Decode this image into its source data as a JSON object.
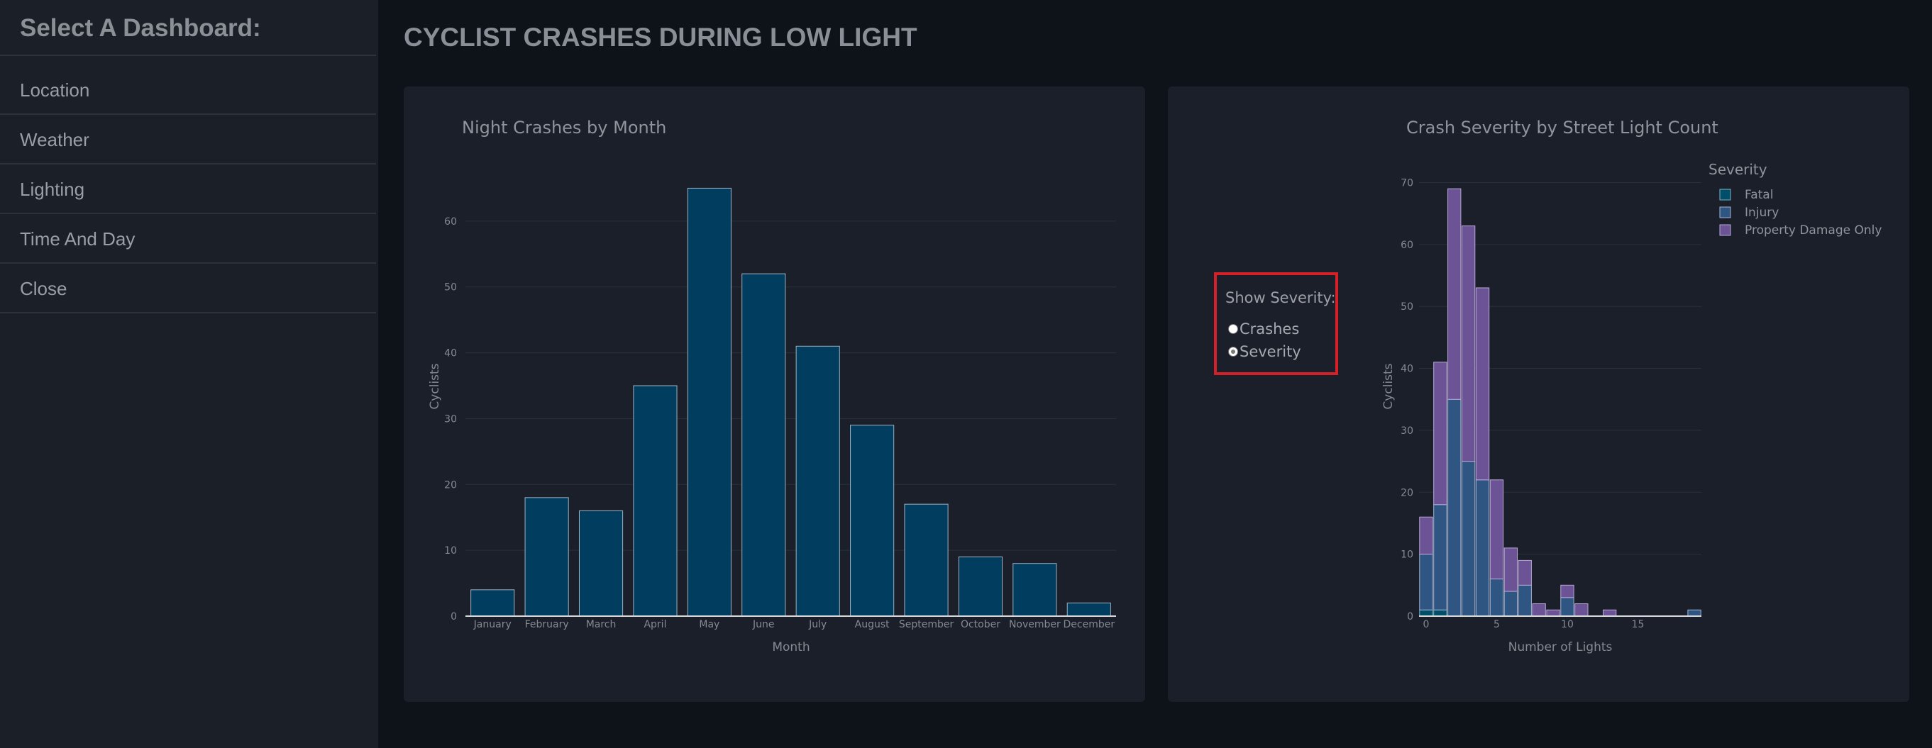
{
  "sidebar": {
    "title": "Select A Dashboard:",
    "items": [
      {
        "label": "Location"
      },
      {
        "label": "Weather"
      },
      {
        "label": "Lighting"
      },
      {
        "label": "Time And Day"
      },
      {
        "label": "Close"
      }
    ]
  },
  "page": {
    "title": "CYCLIST CRASHES DURING LOW LIGHT"
  },
  "severity_control": {
    "label": "Show Severity:",
    "options": [
      {
        "label": "Crashes",
        "checked": false
      },
      {
        "label": "Severity",
        "checked": true
      }
    ]
  },
  "colors": {
    "bar": "#003d5e",
    "fatal": "#004e68",
    "injury": "#2f5583",
    "property_damage_only": "#6b5396",
    "axis_text": "#858a91",
    "panel_bg": "#1b1f29"
  },
  "chart_data": [
    {
      "type": "bar",
      "title": "Night Crashes by Month",
      "xlabel": "Month",
      "ylabel": "Cyclists",
      "categories": [
        "January",
        "February",
        "March",
        "April",
        "May",
        "June",
        "July",
        "August",
        "September",
        "October",
        "November",
        "December"
      ],
      "values": [
        4,
        18,
        16,
        35,
        65,
        52,
        41,
        29,
        17,
        9,
        8,
        2
      ],
      "ylim": [
        0,
        70
      ],
      "yticks": [
        0,
        10,
        20,
        30,
        40,
        50,
        60
      ],
      "grid": true
    },
    {
      "type": "bar",
      "stacked": true,
      "title": "Crash Severity by Street Light Count",
      "xlabel": "Number of Lights",
      "ylabel": "Cyclists",
      "legend_title": "Severity",
      "legend_position": "top-right",
      "x": [
        0,
        1,
        2,
        3,
        4,
        5,
        6,
        7,
        8,
        9,
        10,
        11,
        12,
        13,
        14,
        15,
        16,
        17,
        18,
        19
      ],
      "xlim": [
        -0.5,
        19.5
      ],
      "xticks": [
        0,
        5,
        10,
        15
      ],
      "ylim": [
        0,
        72
      ],
      "yticks": [
        0,
        10,
        20,
        30,
        40,
        50,
        60,
        70
      ],
      "grid": true,
      "series": [
        {
          "name": "Fatal",
          "values": [
            1,
            1,
            0,
            0,
            0,
            0,
            0,
            0,
            0,
            0,
            0,
            0,
            0,
            0,
            0,
            0,
            0,
            0,
            0,
            0
          ]
        },
        {
          "name": "Injury",
          "values": [
            9,
            17,
            35,
            25,
            22,
            6,
            4,
            5,
            0,
            0,
            3,
            0,
            0,
            0,
            0,
            0,
            0,
            0,
            0,
            1
          ]
        },
        {
          "name": "Property Damage Only",
          "values": [
            6,
            23,
            34,
            38,
            31,
            16,
            7,
            4,
            2,
            1,
            2,
            2,
            0,
            1,
            0,
            0,
            0,
            0,
            0,
            0
          ]
        }
      ]
    }
  ]
}
